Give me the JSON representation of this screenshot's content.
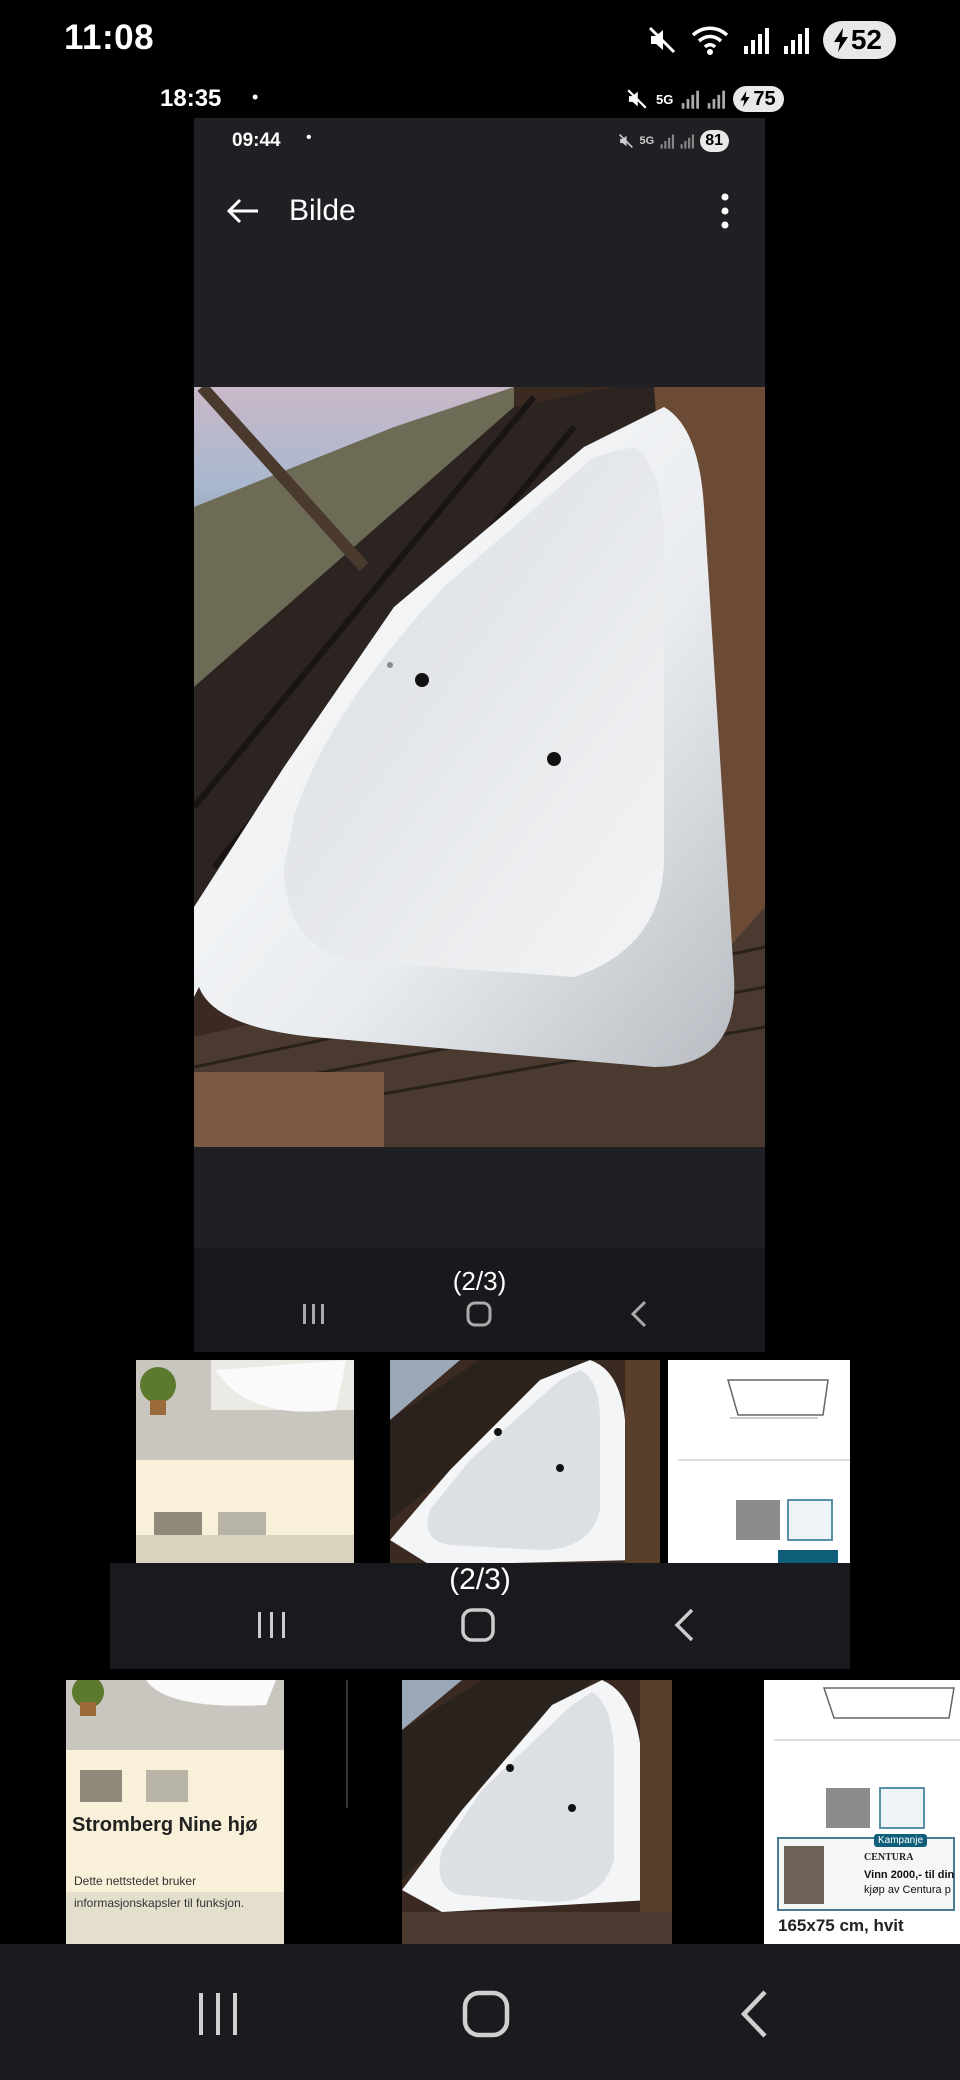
{
  "outer_status": {
    "time": "11:08",
    "battery": "52"
  },
  "mid_status": {
    "time": "18:35",
    "network": "5G",
    "battery": "75"
  },
  "inner_status": {
    "time": "09:44",
    "network": "5G",
    "battery": "81"
  },
  "inner_app": {
    "title": "Bilde"
  },
  "inner_caption": "(2/3)",
  "mid_caption": "(2/3)",
  "listing_thumb": {
    "heading": "Stromberg Nine hjø",
    "line1": "Dette nettstedet bruker",
    "line2": "informasjonskapsler til funksjon."
  },
  "spec_thumb": {
    "badge": "Kampanje",
    "brand": "CENTURA",
    "promo_line1": "Vinn 2000,- til din",
    "promo_line2": "kjøp av Centura p",
    "size_text": "165x75 cm, hvit"
  },
  "colors": {
    "background": "#000000",
    "inner_surface": "#1f1f24",
    "navbar": "#1b1b1f"
  }
}
